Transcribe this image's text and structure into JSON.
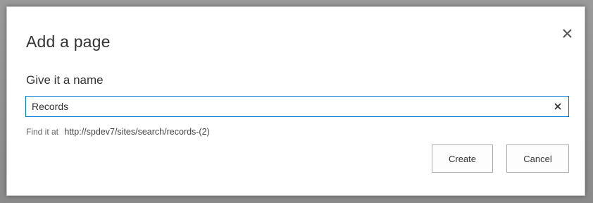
{
  "dialog": {
    "title": "Add a page",
    "close_icon": "close-icon"
  },
  "form": {
    "name_label": "Give it a name",
    "name_value": "Records",
    "clear_icon": "clear-icon",
    "find_label": "Find it at",
    "find_url": "http://spdev7/sites/search/records-(2)"
  },
  "buttons": {
    "create_label": "Create",
    "cancel_label": "Cancel"
  },
  "colors": {
    "focus_border": "#0078d7",
    "text": "#333333",
    "backdrop": "#8e8e8e"
  }
}
